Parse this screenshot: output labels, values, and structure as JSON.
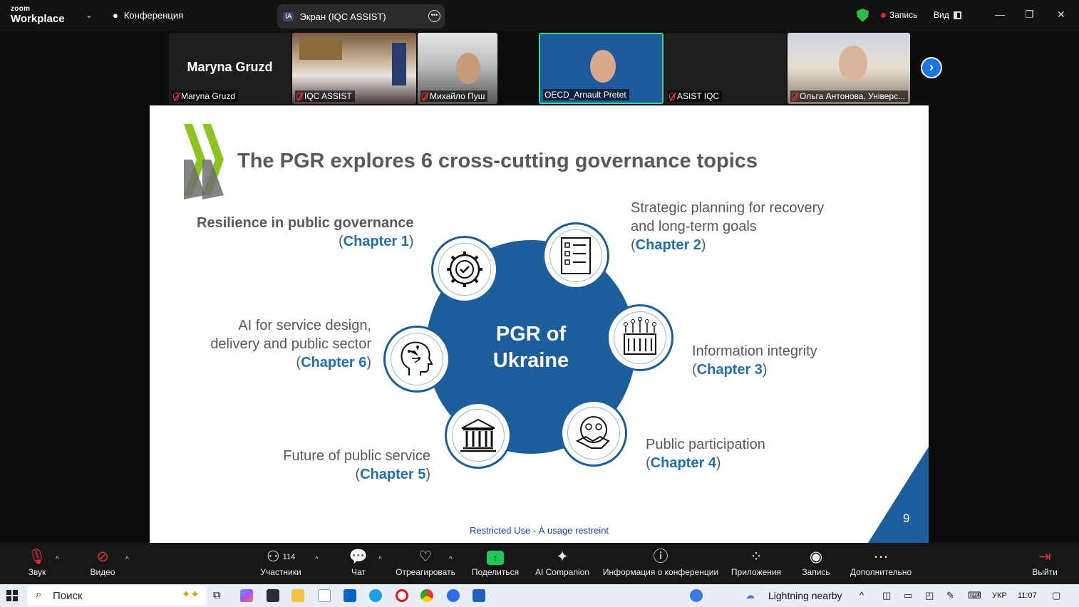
{
  "top": {
    "logo_small": "zoom",
    "logo_big": "Workplace",
    "meeting_label": "Конференция",
    "screen_badge": "IA",
    "screen_label": "Экран (IQC ASSIST)",
    "record_label": "Запись",
    "view_label": "Вид"
  },
  "participants": [
    {
      "name": "Maryna Gruzd",
      "display": "Maryna Gruzd"
    },
    {
      "name": "IQC ASSIST"
    },
    {
      "name": "Михайло Пуш"
    },
    {
      "name": "OECD_Arnault Pretet"
    },
    {
      "name": "ASIST IQC"
    },
    {
      "name": "Ольга Антонова, Універс..."
    }
  ],
  "slide": {
    "title": "The PGR explores 6 cross-cutting governance topics",
    "center_line1": "PGR of",
    "center_line2": "Ukraine",
    "topics": [
      {
        "lines": [
          "Resilience in public governance"
        ],
        "chapter": "Chapter 1"
      },
      {
        "lines": [
          "Strategic planning for recovery",
          "and long-term goals"
        ],
        "chapter": "Chapter 2"
      },
      {
        "lines": [
          "Information integrity"
        ],
        "chapter": "Chapter 3"
      },
      {
        "lines": [
          "Public participation"
        ],
        "chapter": "Chapter 4"
      },
      {
        "lines": [
          "Future of public service"
        ],
        "chapter": "Chapter 5"
      },
      {
        "lines": [
          "AI for service design,",
          "delivery and public sector"
        ],
        "chapter": "Chapter 6"
      }
    ],
    "page_number": "9",
    "footer": "Restricted Use - À usage restreint",
    "accent_color": "#1b5e9b",
    "logo_colors": [
      "#8dc21f",
      "#6d6e70"
    ]
  },
  "toolbar": {
    "audio": "Звук",
    "video": "Видео",
    "participants": "Участники",
    "participants_count": "114",
    "chat": "Чат",
    "react": "Отреагировать",
    "share": "Поделиться",
    "ai": "AI Companion",
    "info": "Информация о конференции",
    "apps": "Приложения",
    "record": "Запись",
    "more": "Дополнительно",
    "leave": "Выйти"
  },
  "taskbar": {
    "search": "Поиск",
    "weather": "Lightning nearby",
    "lang": "УКР",
    "time": "11:07"
  }
}
